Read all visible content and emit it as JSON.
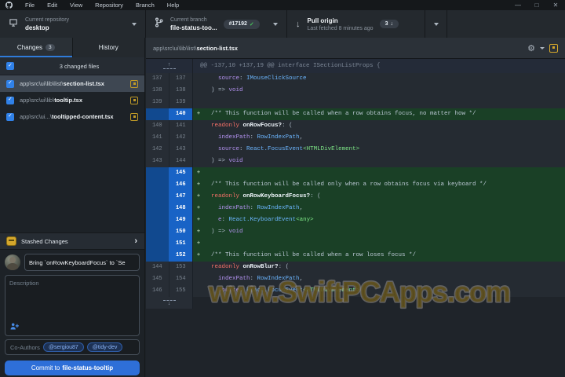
{
  "titlebar": {
    "menus": [
      "File",
      "Edit",
      "View",
      "Repository",
      "Branch",
      "Help"
    ],
    "window_buttons": [
      "minimize",
      "maximize",
      "close"
    ]
  },
  "toolbar": {
    "repository": {
      "label": "Current repository",
      "value": "desktop"
    },
    "branch": {
      "label": "Current branch",
      "value": "file-status-too...",
      "badge": "#17192"
    },
    "pull": {
      "title": "Pull origin",
      "subtitle": "Last fetched 8 minutes ago",
      "badge_count": "3"
    }
  },
  "sidebar": {
    "tabs": [
      {
        "label": "Changes",
        "badge": "3",
        "active": true
      },
      {
        "label": "History",
        "active": false
      }
    ],
    "files_header": "3 changed files",
    "files": [
      {
        "path": "app\\src\\ui\\lib\\list\\",
        "name": "section-list.tsx",
        "selected": true
      },
      {
        "path": "app\\src\\ui\\lib\\",
        "name": "tooltip.tsx",
        "selected": false
      },
      {
        "path": "app\\src\\ui...\\",
        "name": "tooltipped-content.tsx",
        "selected": false
      }
    ],
    "stashed_changes_label": "Stashed Changes",
    "commit": {
      "summary_value": "Bring `onRowKeyboardFocus` to `Se",
      "description_placeholder": "Description",
      "coauthors_label": "Co-Authors",
      "coauthors": [
        "@sergiou87",
        "@tidy-dev"
      ],
      "button_prefix": "Commit to",
      "button_branch": "file-status-tooltip"
    }
  },
  "diff": {
    "file_path_prefix": "app\\src\\ui\\lib\\list\\",
    "file_name": "section-list.tsx",
    "hunk_header": "@@ -137,10 +137,19 @@ interface ISectionListProps {",
    "lines": [
      {
        "old": "137",
        "new": "137",
        "type": "ctx",
        "tokens": [
          [
            "plain",
            "    "
          ],
          [
            "prop",
            "source"
          ],
          [
            "plain",
            ": "
          ],
          [
            "type",
            "IMouseClickSource"
          ]
        ]
      },
      {
        "old": "138",
        "new": "138",
        "type": "ctx",
        "tokens": [
          [
            "plain",
            "  ) => "
          ],
          [
            "void",
            "void"
          ]
        ]
      },
      {
        "old": "139",
        "new": "139",
        "type": "ctx",
        "tokens": []
      },
      {
        "old": "",
        "new": "140",
        "type": "add",
        "tokens": [
          [
            "com",
            "  /** This function will be called when a row obtains focus, no matter how */"
          ]
        ]
      },
      {
        "old": "140",
        "new": "141",
        "type": "ctx",
        "tokens": [
          [
            "plain",
            "  "
          ],
          [
            "kw",
            "readonly"
          ],
          [
            "plain",
            " "
          ],
          [
            "fn",
            "onRowFocus?"
          ],
          [
            "plain",
            ": ("
          ]
        ]
      },
      {
        "old": "141",
        "new": "142",
        "type": "ctx",
        "tokens": [
          [
            "plain",
            "    "
          ],
          [
            "prop",
            "indexPath"
          ],
          [
            "plain",
            ": "
          ],
          [
            "type",
            "RowIndexPath"
          ],
          [
            "plain",
            ","
          ]
        ]
      },
      {
        "old": "142",
        "new": "143",
        "type": "ctx",
        "tokens": [
          [
            "plain",
            "    "
          ],
          [
            "prop",
            "source"
          ],
          [
            "plain",
            ": "
          ],
          [
            "type",
            "React.FocusEvent"
          ],
          [
            "gen",
            "<HTMLDivElement>"
          ]
        ]
      },
      {
        "old": "143",
        "new": "144",
        "type": "ctx",
        "tokens": [
          [
            "plain",
            "  ) => "
          ],
          [
            "void",
            "void"
          ]
        ]
      },
      {
        "old": "",
        "new": "145",
        "type": "add",
        "tokens": []
      },
      {
        "old": "",
        "new": "146",
        "type": "add",
        "tokens": [
          [
            "com",
            "  /** This function will be called only when a row obtains focus via keyboard */"
          ]
        ]
      },
      {
        "old": "",
        "new": "147",
        "type": "add",
        "tokens": [
          [
            "plain",
            "  "
          ],
          [
            "kw",
            "readonly"
          ],
          [
            "plain",
            " "
          ],
          [
            "fn",
            "onRowKeyboardFocus?"
          ],
          [
            "plain",
            ": ("
          ]
        ]
      },
      {
        "old": "",
        "new": "148",
        "type": "add",
        "tokens": [
          [
            "plain",
            "    "
          ],
          [
            "prop",
            "indexPath"
          ],
          [
            "plain",
            ": "
          ],
          [
            "type",
            "RowIndexPath"
          ],
          [
            "plain",
            ","
          ]
        ]
      },
      {
        "old": "",
        "new": "149",
        "type": "add",
        "tokens": [
          [
            "plain",
            "    "
          ],
          [
            "prop",
            "e"
          ],
          [
            "plain",
            ": "
          ],
          [
            "type",
            "React.KeyboardEvent"
          ],
          [
            "gen",
            "<any>"
          ]
        ]
      },
      {
        "old": "",
        "new": "150",
        "type": "add",
        "tokens": [
          [
            "plain",
            "  ) => "
          ],
          [
            "void",
            "void"
          ]
        ]
      },
      {
        "old": "",
        "new": "151",
        "type": "add",
        "tokens": []
      },
      {
        "old": "",
        "new": "152",
        "type": "add",
        "tokens": [
          [
            "com",
            "  /** This function will be called when a row loses focus */"
          ]
        ]
      },
      {
        "old": "144",
        "new": "153",
        "type": "ctx",
        "tokens": [
          [
            "plain",
            "  "
          ],
          [
            "kw",
            "readonly"
          ],
          [
            "plain",
            " "
          ],
          [
            "fn",
            "onRowBlur?"
          ],
          [
            "plain",
            ": ("
          ]
        ]
      },
      {
        "old": "145",
        "new": "154",
        "type": "ctx",
        "tokens": [
          [
            "plain",
            "    "
          ],
          [
            "prop",
            "indexPath"
          ],
          [
            "plain",
            ": "
          ],
          [
            "type",
            "RowIndexPath"
          ],
          [
            "plain",
            ","
          ]
        ]
      },
      {
        "old": "146",
        "new": "155",
        "type": "ctx",
        "tokens": [
          [
            "plain",
            "    "
          ],
          [
            "prop",
            "source"
          ],
          [
            "plain",
            ": "
          ],
          [
            "type",
            "React.FocusEvent"
          ],
          [
            "gen",
            "<HTMLDivElement>"
          ]
        ]
      }
    ]
  },
  "watermark": "www.SwiftPCApps.com",
  "colors": {
    "accent_blue": "#2e6fd8",
    "added_green": "#1a4026",
    "gutter_blue": "#1863c6",
    "modified_yellow": "#d4a72c",
    "check_green": "#46c55a"
  }
}
